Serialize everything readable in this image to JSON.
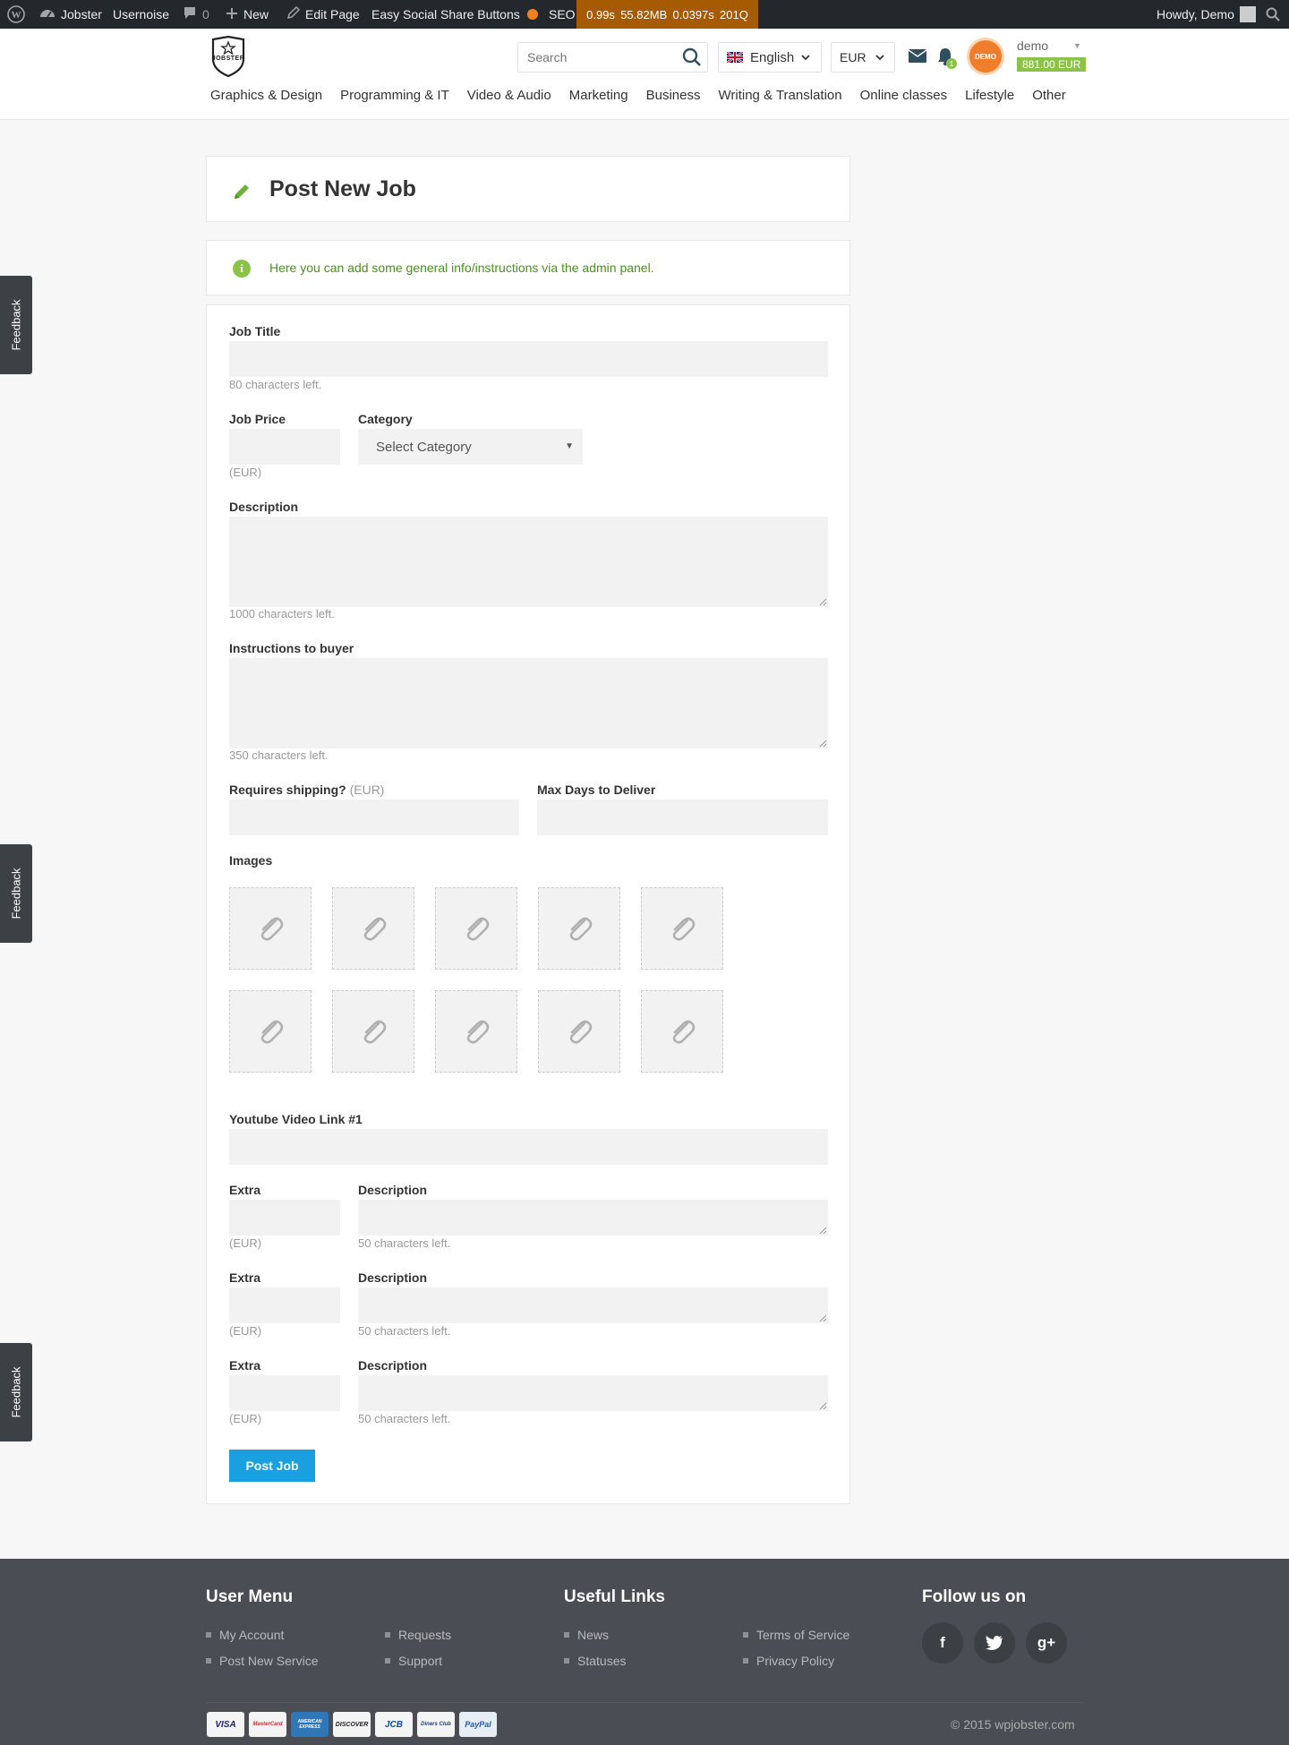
{
  "admin_bar": {
    "site_name": "Jobster",
    "usernoise": "Usernoise",
    "comments_count": "0",
    "new": "New",
    "edit_page": "Edit Page",
    "social_share": "Easy Social Share Buttons",
    "seo": "SEO",
    "qm_time": "0.99s",
    "qm_memory": "55.82MB",
    "qm_query_time": "0.0397s",
    "qm_queries": "201Q",
    "howdy": "Howdy, Demo"
  },
  "header": {
    "logo_text": "JOBSTER",
    "search_placeholder": "Search",
    "language": "English",
    "currency": "EUR",
    "notifications_count": "1",
    "avatar_text": "DEMO",
    "username": "demo",
    "balance": "881.00 EUR",
    "categories": [
      "Graphics & Design",
      "Programming & IT",
      "Video & Audio",
      "Marketing",
      "Business",
      "Writing & Translation",
      "Online classes",
      "Lifestyle",
      "Other"
    ]
  },
  "page": {
    "title": "Post New Job",
    "info": "Here you can add some general info/instructions via the admin panel."
  },
  "form": {
    "job_title_label": "Job Title",
    "job_title_hint": "80 characters left.",
    "job_price_label": "Job Price",
    "job_price_currency": "(EUR)",
    "category_label": "Category",
    "category_value": "Select Category",
    "description_label": "Description",
    "description_hint": "1000 characters left.",
    "instructions_label": "Instructions to buyer",
    "instructions_hint": "350 characters left.",
    "shipping_label": "Requires shipping?",
    "shipping_currency": "(EUR)",
    "max_days_label": "Max Days to Deliver",
    "images_label": "Images",
    "youtube_label": "Youtube Video Link #1",
    "extras": [
      {
        "extra_label": "Extra",
        "currency": "(EUR)",
        "desc_label": "Description",
        "desc_hint": "50 characters left."
      },
      {
        "extra_label": "Extra",
        "currency": "(EUR)",
        "desc_label": "Description",
        "desc_hint": "50 characters left."
      },
      {
        "extra_label": "Extra",
        "currency": "(EUR)",
        "desc_label": "Description",
        "desc_hint": "50 characters left."
      }
    ],
    "submit_label": "Post Job"
  },
  "feedback_label": "Feedback",
  "footer": {
    "user_menu_title": "User Menu",
    "user_menu": [
      "My Account",
      "Requests",
      "Post New Service",
      "Support"
    ],
    "useful_links_title": "Useful Links",
    "useful_links": [
      "News",
      "Terms of Service",
      "Statuses",
      "Privacy Policy"
    ],
    "follow_title": "Follow us on",
    "social": [
      "f",
      "g+"
    ],
    "payments": [
      "VISA",
      "MasterCard",
      "AMERICAN EXPRESS",
      "DISCOVER",
      "JCB",
      "Diners Club",
      "PayPal"
    ],
    "copyright": "© 2015 wpjobster.com"
  },
  "colors": {
    "admin_bar": "#23282d",
    "query_monitor": "#a65b00",
    "accent_green": "#8bc34a",
    "button_blue": "#1a9fe0",
    "avatar_orange": "#ef7d2c",
    "footer_bg": "#4a4d53"
  }
}
